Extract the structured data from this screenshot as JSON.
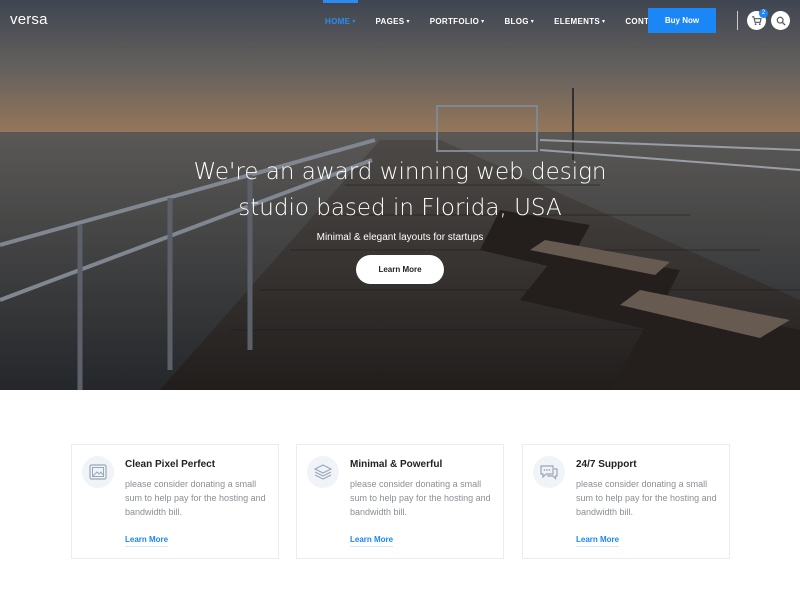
{
  "brand": {
    "logo": "versa",
    "accent": "#1b86f5"
  },
  "nav": {
    "items": [
      {
        "label": "HOME",
        "active": true
      },
      {
        "label": "PAGES"
      },
      {
        "label": "PORTFOLIO"
      },
      {
        "label": "BLOG"
      },
      {
        "label": "ELEMENTS"
      },
      {
        "label": "CONTACT"
      }
    ],
    "cta": "Buy Now",
    "cart_icon": "shopping-cart-icon",
    "cart_count": "2",
    "search_icon": "search-icon"
  },
  "hero": {
    "title_line1": "We're an award winning web design",
    "title_line2": "studio based in Florida, USA",
    "subtitle": "Minimal & elegant layouts for startups",
    "button": "Learn More"
  },
  "features": [
    {
      "icon": "image-icon",
      "title": "Clean Pixel Perfect",
      "text": "please consider donating a small sum to help pay for the hosting and bandwidth bill.",
      "link": "Learn More"
    },
    {
      "icon": "layers-icon",
      "title": "Minimal & Powerful",
      "text": "please consider donating a small sum to help pay for the hosting and bandwidth bill.",
      "link": "Learn More"
    },
    {
      "icon": "chat-icon",
      "title": "24/7 Support",
      "text": "please consider donating a small sum to help pay for the hosting and bandwidth bill.",
      "link": "Learn More"
    }
  ]
}
